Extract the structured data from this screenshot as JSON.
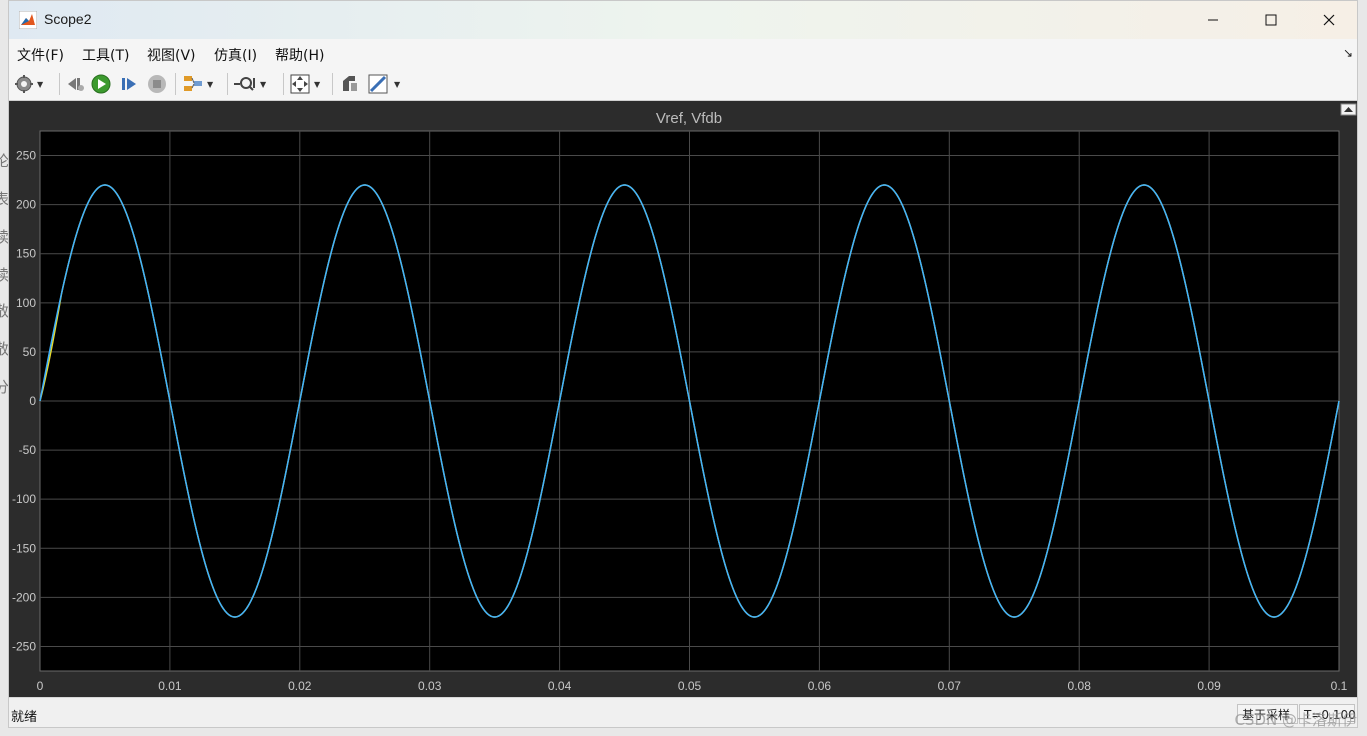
{
  "window": {
    "title": "Scope2"
  },
  "menu": [
    {
      "label": "文件(F)"
    },
    {
      "label": "工具(T)"
    },
    {
      "label": "视图(V)"
    },
    {
      "label": "仿真(I)"
    },
    {
      "label": "帮助(H)"
    }
  ],
  "toolbar": {
    "icons": [
      "settings-icon",
      "step-back-icon",
      "run-icon",
      "step-forward-icon",
      "stop-icon",
      "signal-select-icon",
      "zoom-icon",
      "autoscale-icon",
      "highlight-icon",
      "measure-icon"
    ]
  },
  "background_chars": [
    "论",
    "表",
    "续",
    "续",
    "散",
    "散",
    "分"
  ],
  "chart_data": {
    "type": "line",
    "title": "Vref, Vfdb",
    "xlim": [
      0,
      0.1
    ],
    "ylim": [
      -275,
      275
    ],
    "x_ticks": [
      "0",
      "0.01",
      "0.02",
      "0.03",
      "0.04",
      "0.05",
      "0.06",
      "0.07",
      "0.08",
      "0.09",
      "0.1"
    ],
    "y_ticks": [
      "250",
      "200",
      "150",
      "100",
      "50",
      "0",
      "-50",
      "-100",
      "-150",
      "-200",
      "-250"
    ],
    "grid": true,
    "series": [
      {
        "amplitude": 220,
        "frequency": 50,
        "color": "#e6d92b"
      },
      {
        "amplitude": 220,
        "frequency": 50,
        "color": "#3fb1ff"
      }
    ]
  },
  "status": {
    "text": "就绪",
    "mode": "基于采样",
    "time": "T=0.100"
  },
  "watermark": "CSDN @卡洛斯伊"
}
